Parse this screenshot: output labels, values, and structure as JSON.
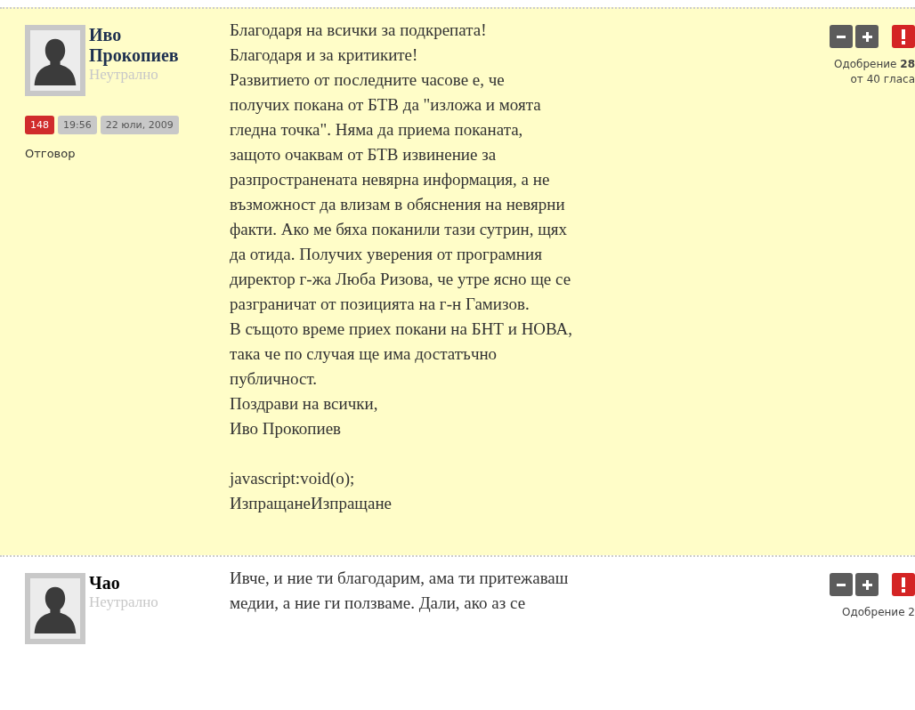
{
  "comments": [
    {
      "author": "Иво Прокопиев",
      "highlighted": true,
      "status": "Неутрално",
      "badges": [
        {
          "text": "148",
          "kind": "rating"
        },
        {
          "text": "19:56",
          "kind": "meta"
        },
        {
          "text": "22 юли, 2009",
          "kind": "meta"
        }
      ],
      "reply": "Отговор",
      "blocks": [
        [
          "Благодаря на всички за подкрепата!",
          "Благодаря и за критиките!",
          "Развитието от последните часове е, че",
          "получих покана от БТВ да \"изложа и моята",
          "гледна точка\". Няма да приема поканата,",
          "защото очаквам от БТВ извинение за",
          "разпространената невярна информация, а не",
          "възможност да влизам в обяснения на невярни",
          "факти. Ако ме бяха поканили тази сутрин, щях",
          "да отида. Получих уверения от програмния",
          "директор г-жа Люба Ризова, че утре ясно ще се",
          "разграничат от позицията на г-н Гамизов.",
          "В същото време приех покани на БНТ и НОВА,",
          "така че по случая ще има достатъчно",
          "публичност.",
          "Поздрави на всички,",
          "Иво Прокопиев"
        ],
        [
          "javascript:void(o);",
          "ИзпращанеИзпращане"
        ]
      ],
      "approval": "Одобрение **28**",
      "votes": "от 40 гласа"
    },
    {
      "author": "Чао",
      "highlighted": false,
      "status": "Неутрално",
      "blocks": [
        [
          "Ивче, и ние ти благодарим, ама ти притежаваш",
          "медии, а ние ги ползваме. Дали, ако аз се"
        ]
      ],
      "approval": "Одобрение 2"
    }
  ]
}
